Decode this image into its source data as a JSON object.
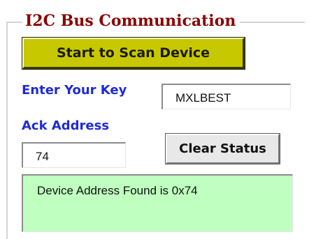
{
  "group": {
    "title": "I2C Bus Communication"
  },
  "scan_button": {
    "label": "Start to Scan Device"
  },
  "key": {
    "label": "Enter Your Key",
    "value": "MXLBEST"
  },
  "ack": {
    "label": "Ack Address",
    "value": "74"
  },
  "clear_button": {
    "label": "Clear Status"
  },
  "status": {
    "text": "Device Address Found is 0x74"
  },
  "colors": {
    "title": "#8b0000",
    "scan_button_bg": "#c8c800",
    "label_blue": "#1f2bd6",
    "status_bg": "#bfffbf"
  }
}
